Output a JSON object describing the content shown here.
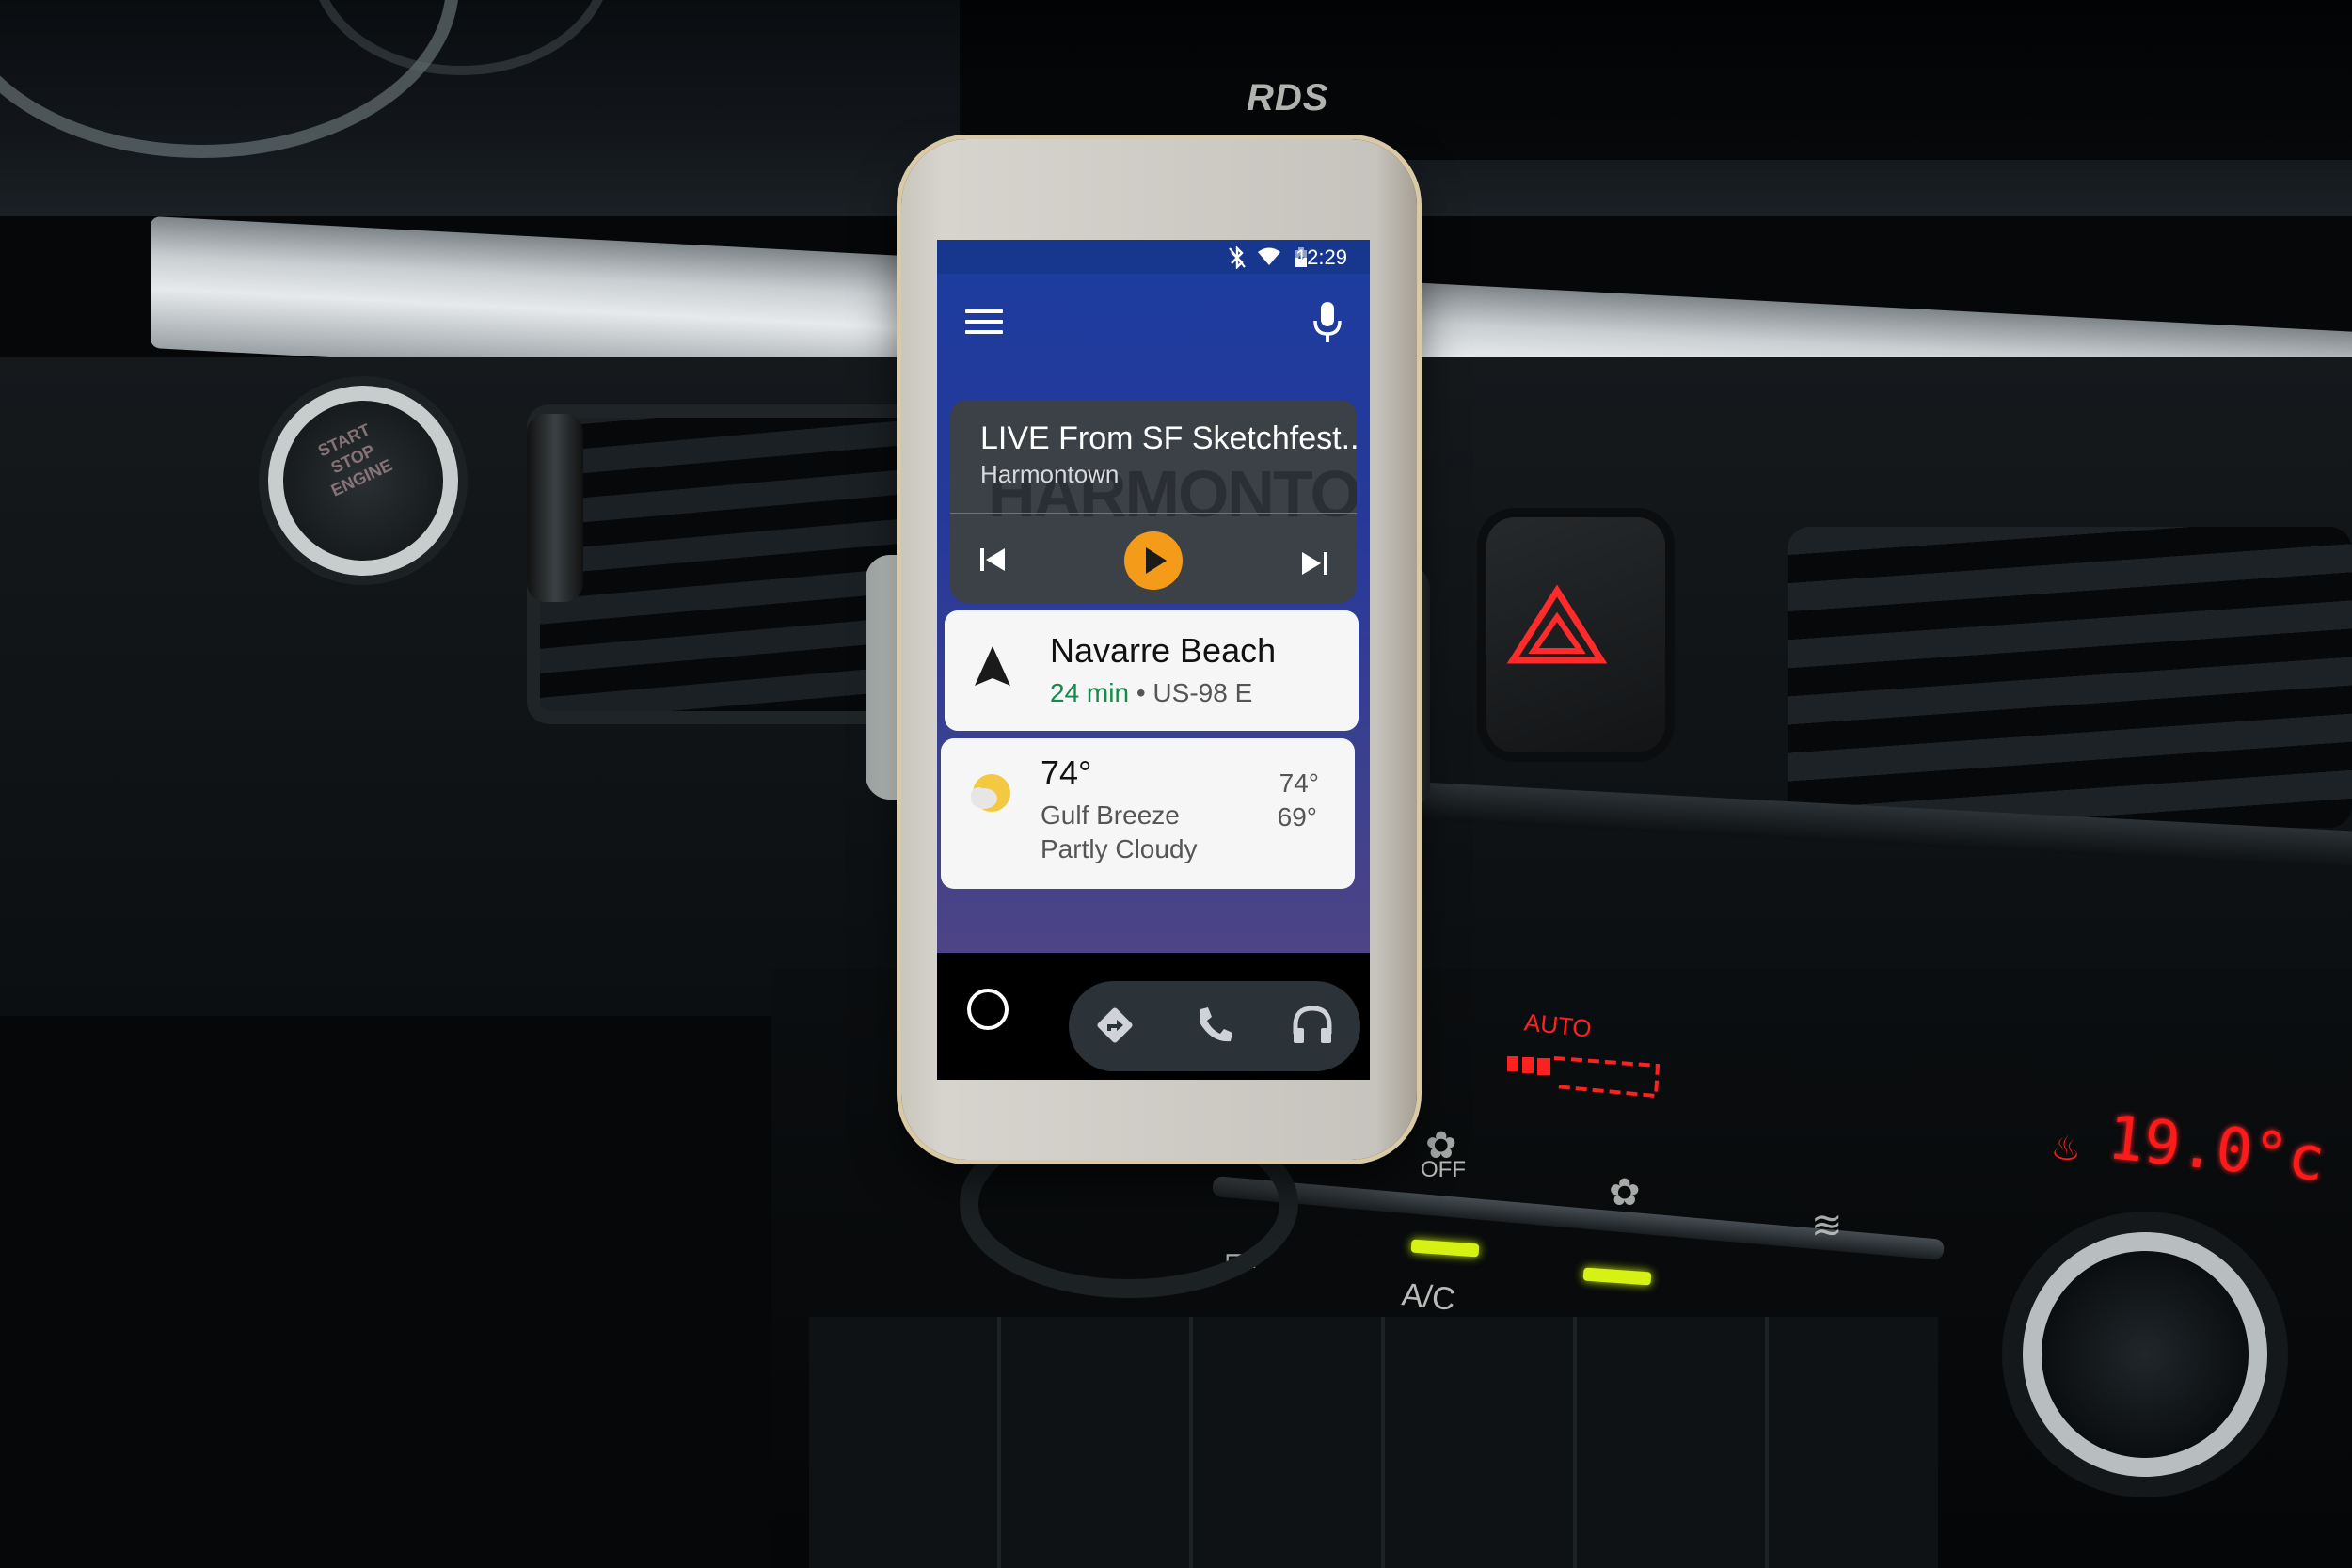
{
  "scene": {
    "background_text": {
      "radio_indicator": "RDS",
      "start_button_label": "START STOP ENGINE",
      "fan_auto_label": "AUTO",
      "fan_auto_level": 0.3,
      "cabin_temperature": "19.0°c",
      "fan_off_label": "OFF",
      "ac_label": "A/C",
      "auto_label": "AUTO"
    },
    "colors": {
      "hazard_red": "#ff2a2a",
      "led_green": "#d6f215"
    }
  },
  "status_bar": {
    "icons": [
      "bluetooth-off-icon",
      "wifi-icon",
      "battery-charging-icon"
    ],
    "time": "12:29"
  },
  "app_bar": {
    "left_icon": "menu-icon",
    "right_icon": "microphone-icon"
  },
  "media_card": {
    "title": "LIVE From SF Sketchfest...",
    "artist": "Harmontown",
    "artwork_text": "HARMONTOWN",
    "controls": [
      "skip-previous-icon",
      "play-icon",
      "skip-next-icon"
    ],
    "accent_color": "#f49b1a"
  },
  "nav_card": {
    "destination": "Navarre Beach",
    "eta": "24 min",
    "separator": " • ",
    "route": "US-98 E",
    "eta_color": "#158a4a"
  },
  "weather_card": {
    "current_temp": "74°",
    "city": "Gulf Breeze",
    "condition": "Partly Cloudy",
    "high": "74°",
    "low": "69°"
  },
  "bottom_bar": {
    "home_icon": "home-circle-icon",
    "apps": [
      {
        "name": "navigation",
        "icon": "directions-icon"
      },
      {
        "name": "phone",
        "icon": "phone-icon"
      },
      {
        "name": "music",
        "icon": "headphones-icon"
      }
    ]
  }
}
